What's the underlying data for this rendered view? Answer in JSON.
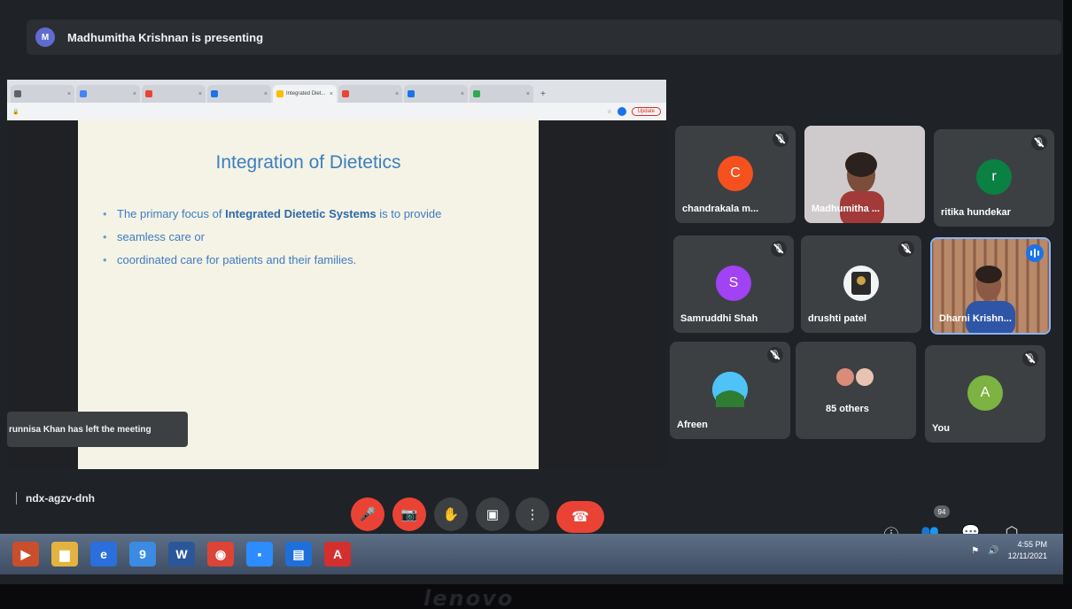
{
  "banner": {
    "avatar_letter": "M",
    "text": "Madhumitha Krishnan is presenting"
  },
  "browser": {
    "tabs": [
      {
        "label": "",
        "color": "#5f6368",
        "active": false
      },
      {
        "label": "",
        "color": "#4285f4",
        "active": false
      },
      {
        "label": "",
        "color": "#ea4335",
        "active": false
      },
      {
        "label": "",
        "color": "#1a73e8",
        "active": false
      },
      {
        "label": "Integrated Diet...",
        "color": "#fbbc04",
        "active": true
      },
      {
        "label": "",
        "color": "#ea4335",
        "active": false
      },
      {
        "label": "",
        "color": "#1a73e8",
        "active": false
      },
      {
        "label": "",
        "color": "#34a853",
        "active": false
      }
    ],
    "new_tab": "+",
    "update_label": "Update"
  },
  "slide": {
    "title": "Integration of Dietetics",
    "bullet1_pre": "The primary focus of ",
    "bullet1_bold": "Integrated Dietetic Systems",
    "bullet1_post": " is to provide",
    "bullet2": "seamless care or",
    "bullet3": "coordinated care for patients and their families."
  },
  "toast": {
    "text": "runnisa Khan has left the meeting"
  },
  "participants": [
    {
      "name": "chandrakala m...",
      "letter": "C",
      "color": "#f4511e",
      "muted": true,
      "video": false
    },
    {
      "name": "Madhumitha ...",
      "letter": "",
      "color": "",
      "muted": false,
      "video": true
    },
    {
      "name": "ritika hundekar",
      "letter": "r",
      "color": "#0b8043",
      "muted": true,
      "video": false
    },
    {
      "name": "Samruddhi Shah",
      "letter": "S",
      "color": "#a142f4",
      "muted": true,
      "video": false
    },
    {
      "name": "drushti patel",
      "letter": "",
      "color": "#f1f3f4",
      "muted": true,
      "video": false
    },
    {
      "name": "Dharni Krishn...",
      "letter": "",
      "color": "",
      "muted": false,
      "video": true
    },
    {
      "name": "Afreen",
      "letter": "",
      "color": "#4fc3f7",
      "muted": true,
      "video": false
    },
    {
      "name": "85 others",
      "letter": "",
      "color": "",
      "muted": false,
      "video": false
    },
    {
      "name": "You",
      "letter": "A",
      "color": "#7cb342",
      "muted": true,
      "video": false
    }
  ],
  "meeting_code": "ndx-agzv-dnh",
  "controls": {
    "mic": "🎤",
    "camera": "📷",
    "hand": "✋",
    "present": "▣",
    "more": "⋮",
    "leave": "☎"
  },
  "right_controls": {
    "info": "ⓘ",
    "people": "👥",
    "people_count": "94",
    "chat": "💬",
    "activities": "⬡"
  },
  "taskbar": {
    "time": "4:55 PM",
    "date": "12/11/2021"
  },
  "colors": {
    "accent": "#1a73e8",
    "danger": "#ea4335",
    "tile": "#3c4043",
    "slide_text": "#3f7cc0"
  }
}
